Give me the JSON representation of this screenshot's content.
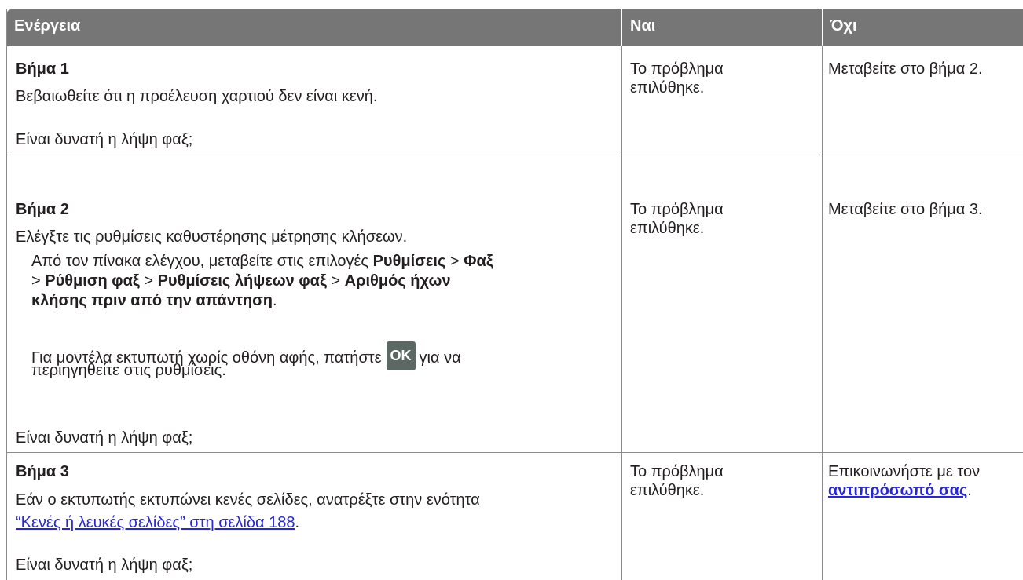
{
  "header": {
    "action": "Ενέργεια",
    "yes": "Ναι",
    "no": "Όχι"
  },
  "rows": [
    {
      "step": "Βήμα 1",
      "line1": "Βεβαιωθείτε ότι η προέλευση χαρτιού δεν είναι κενή.",
      "question": "Είναι δυνατή η λήψη φαξ;",
      "yes": [
        "Το πρόβλημα",
        "επιλύθηκε."
      ],
      "no": "Μεταβείτε στο βήμα 2."
    },
    {
      "step": "Βήμα 2",
      "line1": "Ελέγξτε τις ρυθμίσεις καθυστέρησης μέτρησης κλήσεων.",
      "nav_intro": "Από τον πίνακα ελέγχου, μεταβείτε στις επιλογές ",
      "nav_settings": "Ρυθμίσεις",
      "sep": " > ",
      "nav_fax": "Φαξ",
      "nav_fax_setup": "Ρύθμιση φαξ",
      "nav_receive": "Ρυθμίσεις λήψεων φαξ",
      "nav_rings_a": "Αριθμός ήχων",
      "nav_rings_b": "κλήσης πριν από την απάντηση",
      "period": ".",
      "tip_a": "Για μοντέλα εκτυπωτή χωρίς οθόνη αφής, πατήστε",
      "ok_button": "OK",
      "tip_b": "για να",
      "tip_c": "περιηγηθείτε στις ρυθμίσεις.",
      "question": "Είναι δυνατή η λήψη φαξ;",
      "yes": [
        "Το πρόβλημα",
        "επιλύθηκε."
      ],
      "no": "Μεταβείτε στο βήμα 3."
    },
    {
      "step": "Βήμα 3",
      "line1": "Εάν ο εκτυπωτής εκτυπώνει κενές σελίδες, ανατρέξτε στην ενότητα",
      "link": "“Κενές ή λευκές σελίδες” στη σελίδα  188",
      "period": ".",
      "question": "Είναι δυνατή η λήψη φαξ;",
      "yes": [
        "Το πρόβλημα",
        "επιλύθηκε."
      ],
      "no_a": "Επικοινωνήστε με τον",
      "no_link": "αντιπρόσωπό σας",
      "no_period": "."
    }
  ]
}
